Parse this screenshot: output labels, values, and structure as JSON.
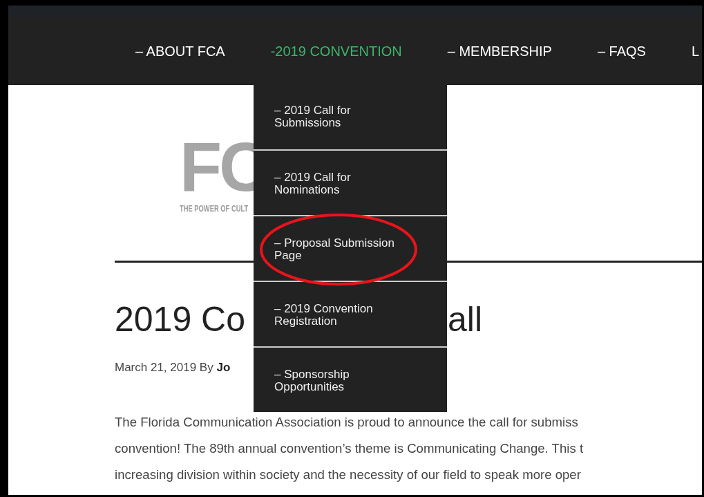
{
  "nav": [
    {
      "label": "– ABOUT FCA",
      "selected": false
    },
    {
      "label": "-2019 CONVENTION",
      "selected": true
    },
    {
      "label": "– MEMBERSHIP",
      "selected": false
    },
    {
      "label": "– FAQS",
      "selected": false
    },
    {
      "label": "L",
      "selected": false
    }
  ],
  "dropdown": [
    {
      "label": "– 2019 Call for Submissions",
      "circled": false
    },
    {
      "label": "– 2019 Call for Nominations",
      "circled": false
    },
    {
      "label": "– Proposal Submission Page",
      "circled": true
    },
    {
      "label": "– 2019 Convention Registration",
      "circled": false
    },
    {
      "label": "– Sponsorship Opportunities",
      "circled": false
    }
  ],
  "logo": {
    "text": "FC",
    "tagline": "THE POWER OF CULT"
  },
  "post": {
    "title_parts": [
      "2019 Co",
      "all"
    ],
    "meta": "March 21, 2019 By **Jo**",
    "lines": [
      "The Florida Communication Association is proud to announce the call for submiss",
      "convention! The 89th annual convention’s theme is Communicating Change. This t",
      "increasing division within society and the necessity of our field to speak more oper"
    ]
  }
}
